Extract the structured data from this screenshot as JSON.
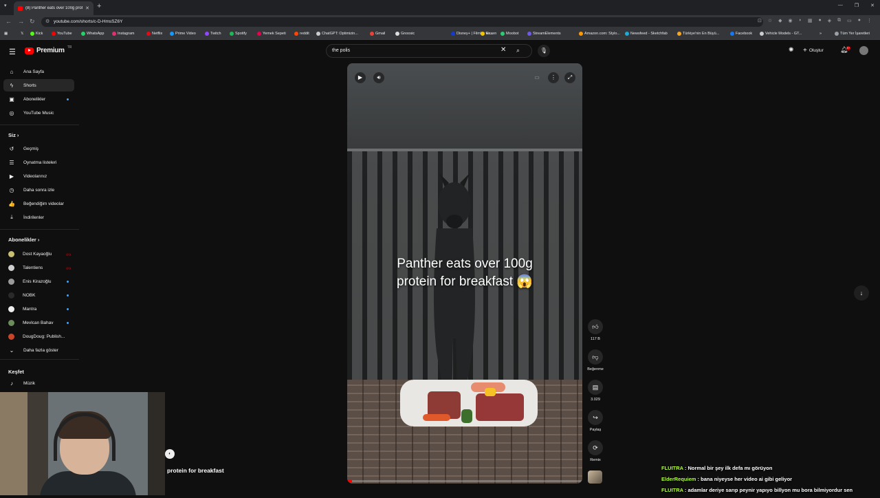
{
  "browser": {
    "tab_title": "(8) Panther eats over 100g prot",
    "url": "youtube.com/shorts/c-D-HmsSZ6Y",
    "bookmarks": [
      {
        "label": "Kick",
        "color": "#53fc18"
      },
      {
        "label": "YouTube",
        "color": "#ff0000"
      },
      {
        "label": "WhatsApp",
        "color": "#25d366"
      },
      {
        "label": "Instagram",
        "color": "#e1306c"
      },
      {
        "label": "Netflix",
        "color": "#e50914"
      },
      {
        "label": "Prime Video",
        "color": "#1399ff"
      },
      {
        "label": "Twitch",
        "color": "#9146ff"
      },
      {
        "label": "Spotify",
        "color": "#1db954"
      },
      {
        "label": "Yemek Sepeti",
        "color": "#ea004b"
      },
      {
        "label": "reddit",
        "color": "#ff4500"
      },
      {
        "label": "ChatGPT: Optimizin...",
        "color": "#cccccc"
      },
      {
        "label": "Gmail",
        "color": "#ea4335"
      },
      {
        "label": "Gnoosic",
        "color": "#dddddd"
      },
      {
        "label": "Disney+ | Filmler ve...",
        "color": "#113ccf"
      },
      {
        "label": "Exxen",
        "color": "#f4c400"
      },
      {
        "label": "Moobot",
        "color": "#2ecc71"
      },
      {
        "label": "StreamElements",
        "color": "#6d5ae8"
      },
      {
        "label": "Amazon.com: Stylo...",
        "color": "#ff9900"
      },
      {
        "label": "Newsfeed - Sketchfab",
        "color": "#1caad9"
      },
      {
        "label": "Türkiye'nin En Büyü...",
        "color": "#f5a623"
      },
      {
        "label": "Facebook",
        "color": "#1877f2"
      },
      {
        "label": "Vehicle Models - GT...",
        "color": "#cccccc"
      },
      {
        "label": "Tüm Yer İşaretleri",
        "color": "#9aa0a6"
      }
    ]
  },
  "header": {
    "logo_text": "Premium",
    "logo_sup": "TR",
    "search_value": "the polis",
    "create_label": "Oluştur",
    "notification_count": "9+"
  },
  "sidebar": {
    "main": [
      {
        "label": "Ana Sayfa",
        "icon": "home-icon",
        "glyph": "⌂"
      },
      {
        "label": "Shorts",
        "icon": "shorts-icon",
        "glyph": "ϟ"
      },
      {
        "label": "Abonelikler",
        "icon": "subscriptions-icon",
        "glyph": "▣"
      },
      {
        "label": "YouTube Music",
        "icon": "music-circle-icon",
        "glyph": "◎"
      }
    ],
    "you_heading": "Siz",
    "you_items": [
      {
        "label": "Geçmiş",
        "icon": "history-icon",
        "glyph": "↺"
      },
      {
        "label": "Oynatma listeleri",
        "icon": "playlist-icon",
        "glyph": "☰"
      },
      {
        "label": "Videolarınız",
        "icon": "your-videos-icon",
        "glyph": "▶"
      },
      {
        "label": "Daha sonra izle",
        "icon": "watch-later-icon",
        "glyph": "◷"
      },
      {
        "label": "Beğendiğim videolar",
        "icon": "liked-icon",
        "glyph": "👍"
      },
      {
        "label": "İndirilenler",
        "icon": "download-icon",
        "glyph": "⤓"
      }
    ],
    "subs_heading": "Abonelikler",
    "channels": [
      {
        "label": "Dost Kayaoğlu",
        "color": "#c8c070",
        "status": "live"
      },
      {
        "label": "Talentiens",
        "color": "#cfcfcf",
        "status": "live"
      },
      {
        "label": "Enis Kirazoğlu",
        "color": "#9a9a9a",
        "status": "new"
      },
      {
        "label": "NOBK",
        "color": "#2a2a2a",
        "status": "new"
      },
      {
        "label": "Mantra",
        "color": "#eeeeee",
        "status": "new"
      },
      {
        "label": "Mevlcan Bahav",
        "color": "#6c8c5c",
        "status": "new"
      },
      {
        "label": "DougDoug: Publish...",
        "color": "#c8452a",
        "status": ""
      }
    ],
    "more_label": "Daha fazla göster",
    "explore_heading": "Keşfet",
    "explore_items": [
      {
        "label": "Müzik",
        "icon": "music-note-icon",
        "glyph": "♪"
      }
    ]
  },
  "player": {
    "caption_line1": "Panther eats over 100g",
    "caption_line2": "protein for breakfast 😱",
    "progress_fraction": 0.02
  },
  "actions": {
    "like_count": "117 B",
    "dislike_label": "Beğenme",
    "comment_count": "3.029",
    "share_label": "Paylaş",
    "remix_label": "Remix"
  },
  "stream_overlay": {
    "caption": "protein for breakfast"
  },
  "chat": [
    {
      "user": "FLUITRA",
      "user_color": "#b3ff3b",
      "message": "Normal bir şey ilk defa mı görüyon"
    },
    {
      "user": "ElderRequiem",
      "user_color": "#b3ff3b",
      "message": "bana niyeyse her video ai gibi geliyor"
    },
    {
      "user": "FLUITRA",
      "user_color": "#b3ff3b",
      "message": "adamlar deriye sarıp peynir yapıyo billyon mu bora bilmiyordur sen"
    }
  ]
}
